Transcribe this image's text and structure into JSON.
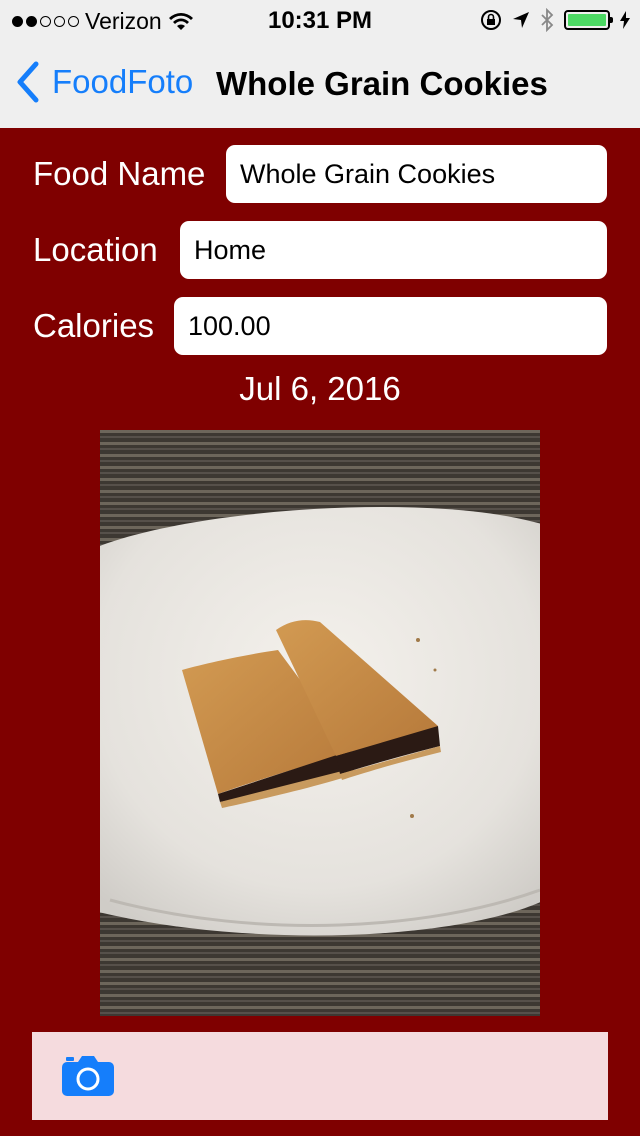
{
  "status_bar": {
    "carrier": "Verizon",
    "time": "10:31 PM"
  },
  "nav": {
    "back_label": "FoodFoto",
    "title": "Whole Grain Cookies"
  },
  "form": {
    "food_name_label": "Food Name",
    "food_name_value": "Whole Grain Cookies",
    "location_label": "Location",
    "location_value": "Home",
    "calories_label": "Calories",
    "calories_value": "100.00"
  },
  "date": "Jul 6, 2016",
  "colors": {
    "background": "#7f0000",
    "accent": "#157efb",
    "toolbar": "#f5dbde"
  }
}
